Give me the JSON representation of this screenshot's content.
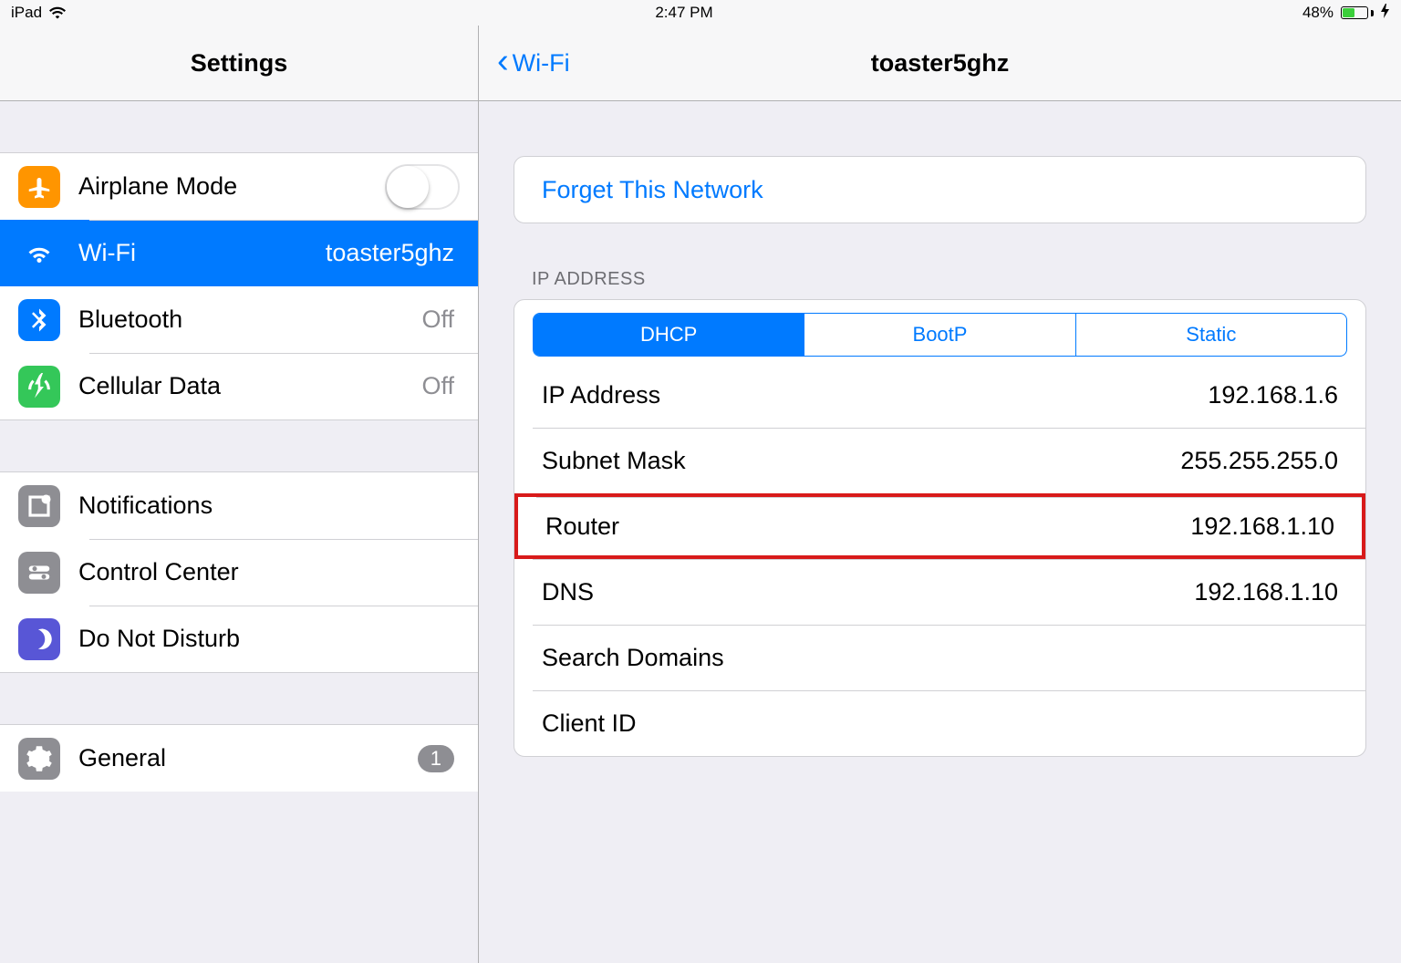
{
  "status": {
    "device": "iPad",
    "time": "2:47 PM",
    "battery_pct": "48%"
  },
  "sidebar": {
    "title": "Settings",
    "group1": {
      "airplane": "Airplane Mode",
      "wifi": "Wi-Fi",
      "wifi_value": "toaster5ghz",
      "bluetooth": "Bluetooth",
      "bluetooth_value": "Off",
      "cellular": "Cellular Data",
      "cellular_value": "Off"
    },
    "group2": {
      "notifications": "Notifications",
      "control_center": "Control Center",
      "dnd": "Do Not Disturb"
    },
    "group3": {
      "general": "General",
      "general_badge": "1"
    }
  },
  "detail": {
    "back_label": "Wi-Fi",
    "title": "toaster5ghz",
    "forget": "Forget This Network",
    "ip_section": "IP ADDRESS",
    "segments": {
      "dhcp": "DHCP",
      "bootp": "BootP",
      "static": "Static"
    },
    "fields": {
      "ip_address_label": "IP Address",
      "ip_address_value": "192.168.1.6",
      "subnet_label": "Subnet Mask",
      "subnet_value": "255.255.255.0",
      "router_label": "Router",
      "router_value": "192.168.1.10",
      "dns_label": "DNS",
      "dns_value": "192.168.1.10",
      "search_label": "Search Domains",
      "search_value": "",
      "client_label": "Client ID",
      "client_value": ""
    }
  }
}
